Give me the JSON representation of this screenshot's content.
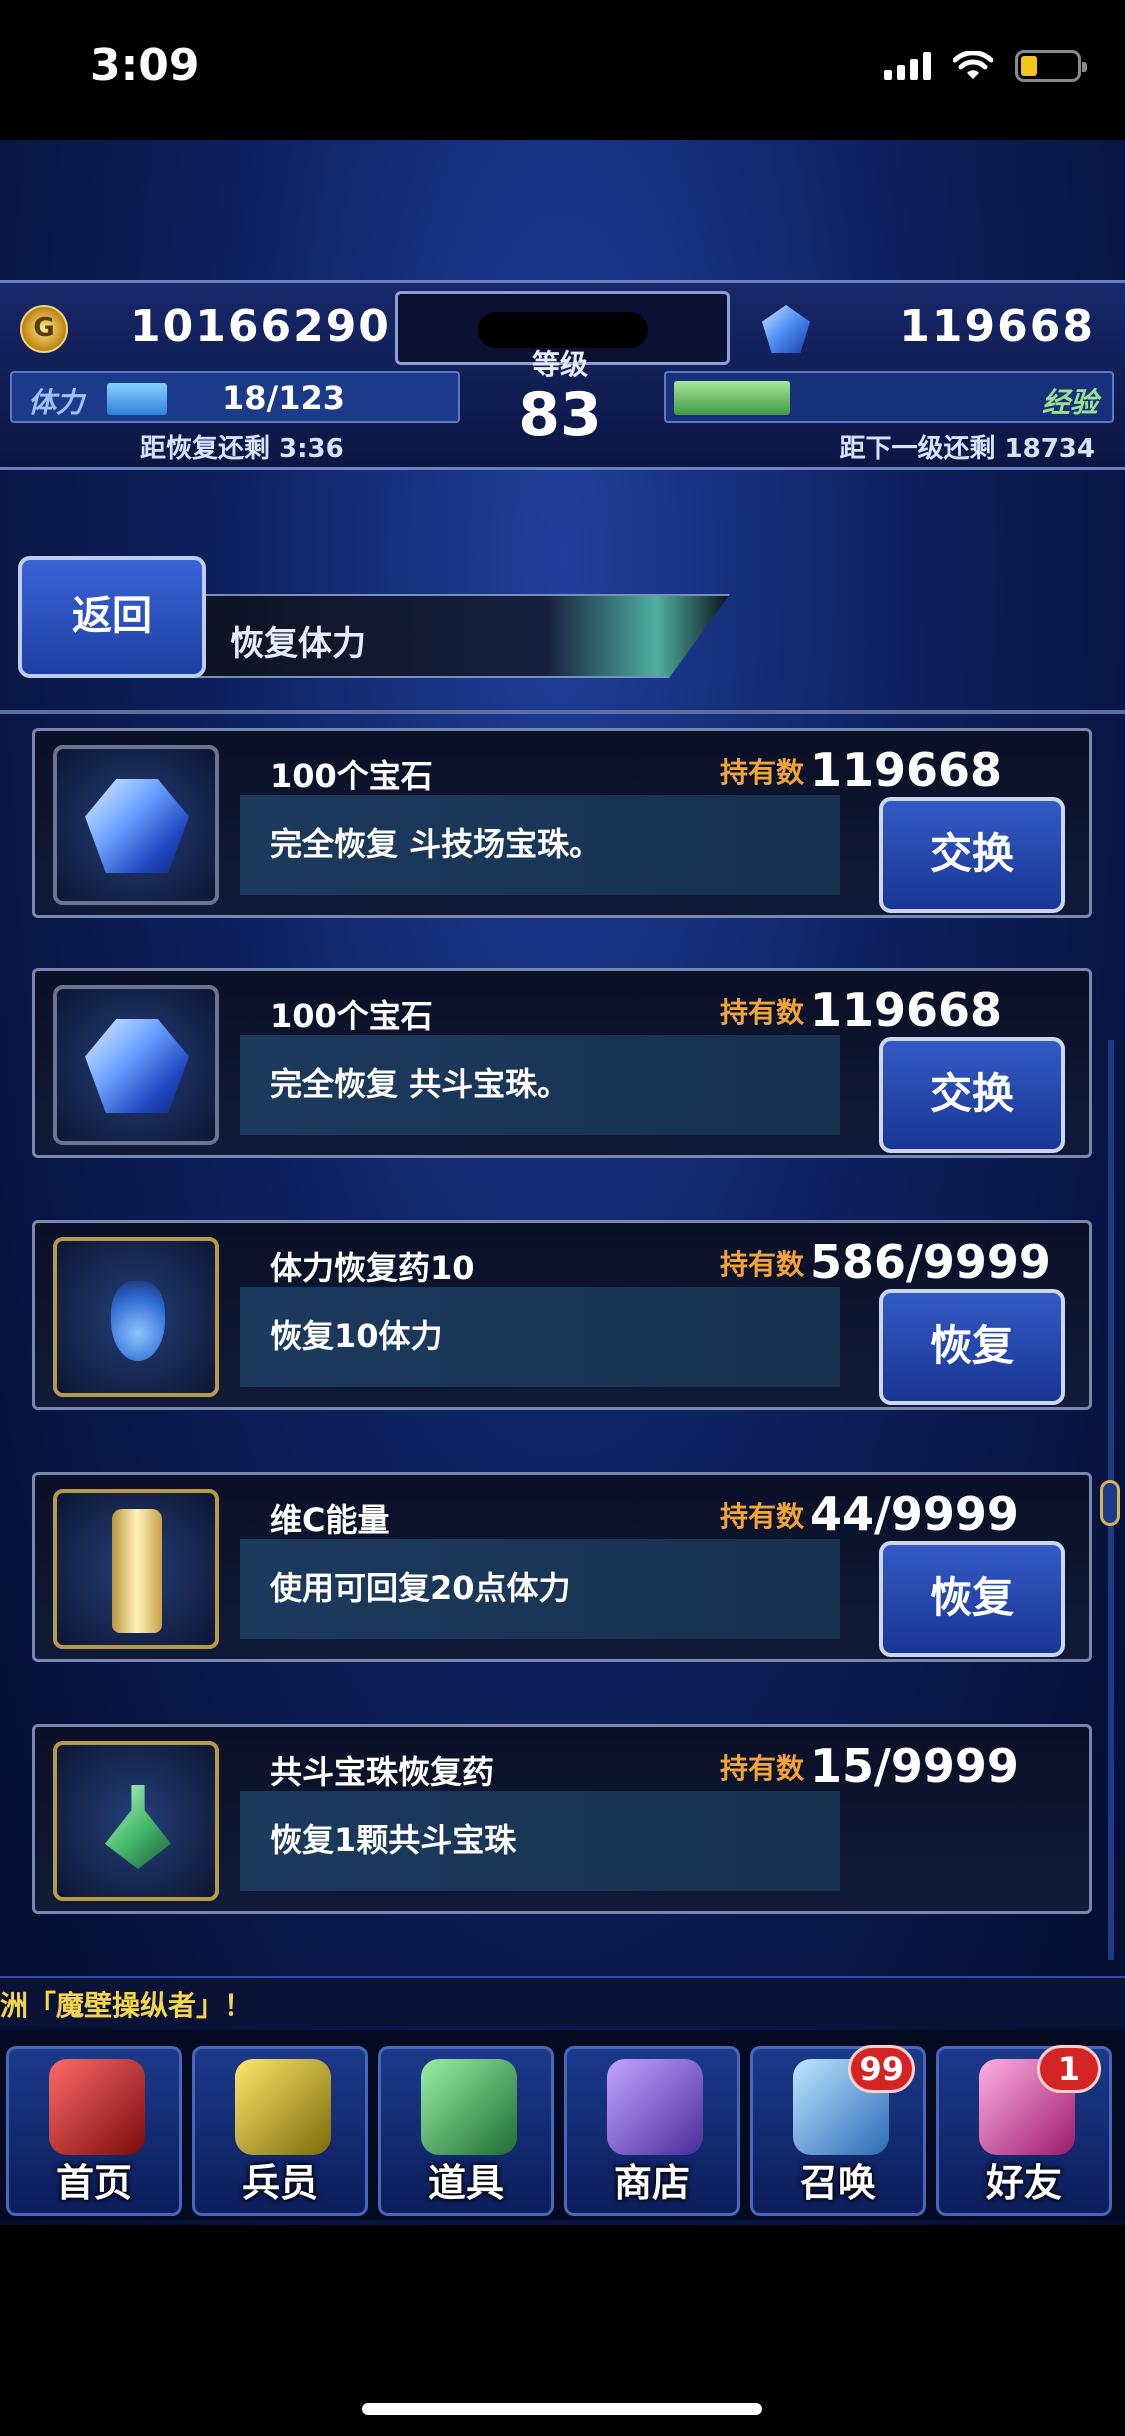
{
  "status_bar": {
    "time": "3:09",
    "icons": [
      "cellular-signal-icon",
      "wifi-icon",
      "battery-icon"
    ]
  },
  "header": {
    "gold": "10166290",
    "gems": "119668",
    "level_label": "等级",
    "level": "83",
    "stamina_label": "体力",
    "stamina": "18/123",
    "stamina_fill": 0.146,
    "recovery_text": "距恢复还剩 3:36",
    "exp_label": "经验",
    "exp_fill": 0.26,
    "next_level_text": "距下一级还剩 18734"
  },
  "title_bar": {
    "back_label": "返回",
    "title": "恢复体力"
  },
  "items": [
    {
      "icon": "gem-icon",
      "name": "100个宝石",
      "desc": "完全恢复 斗技场宝珠。",
      "held_label": "持有数",
      "held": "119668",
      "action": "交换"
    },
    {
      "icon": "gem-icon",
      "name": "100个宝石",
      "desc": "完全恢复 共斗宝珠。",
      "held_label": "持有数",
      "held": "119668",
      "action": "交换"
    },
    {
      "icon": "potion-icon",
      "name": "体力恢复药10",
      "desc": "恢复10体力",
      "held_label": "持有数",
      "held": "586/9999",
      "action": "恢复"
    },
    {
      "icon": "drink-bottle-icon",
      "name": "维C能量",
      "desc": "使用可回复20点体力",
      "held_label": "持有数",
      "held": "44/9999",
      "action": "恢复"
    },
    {
      "icon": "vial-icon",
      "name": "共斗宝珠恢复药",
      "desc": "恢复1颗共斗宝珠",
      "held_label": "持有数",
      "held": "15/9999",
      "action": ""
    }
  ],
  "marquee": "洲「魔壁操纵者」！",
  "bottom_nav": [
    {
      "label": "首页",
      "icon": "swords-icon",
      "badge": ""
    },
    {
      "label": "兵员",
      "icon": "warrior-icon",
      "badge": ""
    },
    {
      "label": "道具",
      "icon": "potion-icon",
      "badge": ""
    },
    {
      "label": "商店",
      "icon": "shop-icon",
      "badge": ""
    },
    {
      "label": "召唤",
      "icon": "crystal-icon",
      "badge": "99"
    },
    {
      "label": "好友",
      "icon": "friends-icon",
      "badge": "1"
    }
  ],
  "colors": {
    "accent_blue": "#1d3ea3",
    "held_label_orange": "#f2a33a",
    "marquee_yellow": "#f5d54b",
    "badge_red": "#d42424"
  }
}
